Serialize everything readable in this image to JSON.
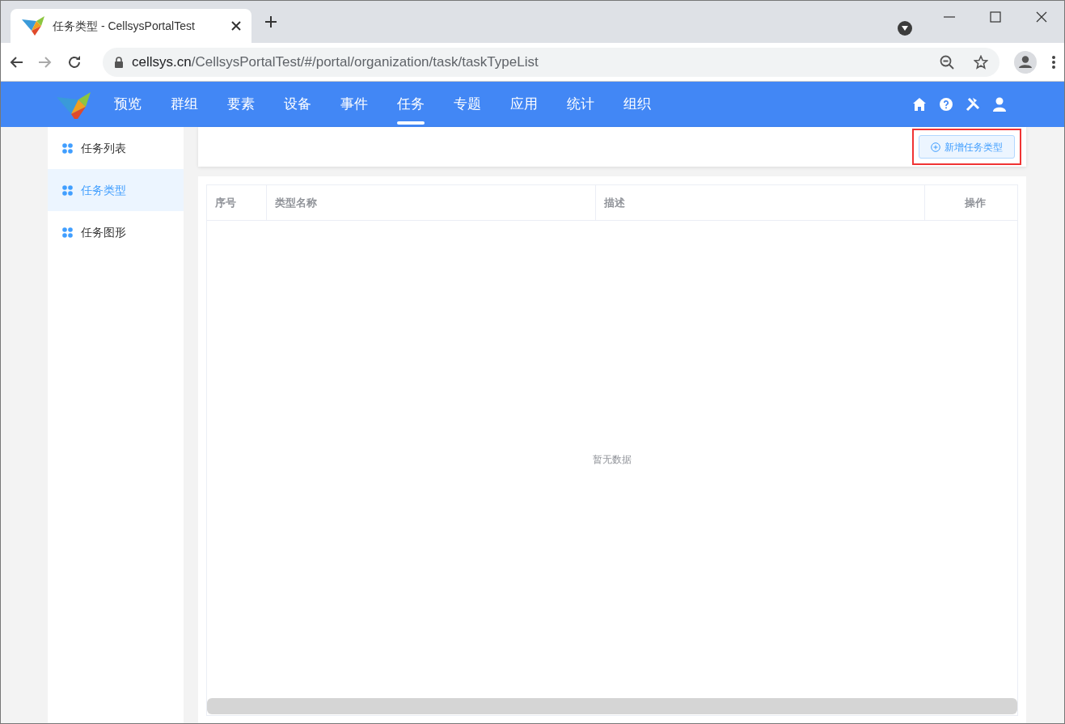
{
  "browser": {
    "tab_title": "任务类型 - CellsysPortalTest",
    "url_host": "cellsys.cn",
    "url_path": "/CellsysPortalTest/#/portal/organization/task/taskTypeList"
  },
  "nav": {
    "items": [
      {
        "label": "预览",
        "selected": false
      },
      {
        "label": "群组",
        "selected": false
      },
      {
        "label": "要素",
        "selected": false
      },
      {
        "label": "设备",
        "selected": false
      },
      {
        "label": "事件",
        "selected": false
      },
      {
        "label": "任务",
        "selected": true
      },
      {
        "label": "专题",
        "selected": false
      },
      {
        "label": "应用",
        "selected": false
      },
      {
        "label": "统计",
        "selected": false
      },
      {
        "label": "组织",
        "selected": false
      }
    ]
  },
  "sidebar": {
    "items": [
      {
        "label": "任务列表",
        "selected": false
      },
      {
        "label": "任务类型",
        "selected": true
      },
      {
        "label": "任务图形",
        "selected": false
      }
    ]
  },
  "toolbar": {
    "add_button": {
      "label": "新增任务类型",
      "highlighted": true
    }
  },
  "table": {
    "columns": [
      "序号",
      "类型名称",
      "描述",
      "操作"
    ],
    "empty_text": "暂无数据"
  }
}
